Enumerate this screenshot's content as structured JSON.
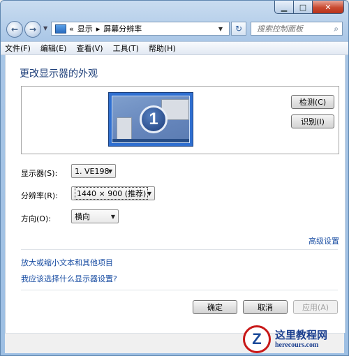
{
  "navigation": {
    "address_prefix": "«",
    "breadcrumb": [
      "显示",
      "屏幕分辨率"
    ],
    "search_placeholder": "搜索控制面板"
  },
  "menu": [
    "文件(F)",
    "编辑(E)",
    "查看(V)",
    "工具(T)",
    "帮助(H)"
  ],
  "main": {
    "title": "更改显示器的外观",
    "monitor_number": "1",
    "detect_button": "检测(C)",
    "identify_button": "识别(I)",
    "display_label": "显示器(S):",
    "display_value": "1. VE198",
    "resolution_label": "分辨率(R):",
    "resolution_value": "1440 × 900 (推荐)",
    "orientation_label": "方向(O):",
    "orientation_value": "横向",
    "advanced_link": "高级设置",
    "link_text_size": "放大或缩小文本和其他项目",
    "link_which_settings": "我应该选择什么显示器设置?"
  },
  "buttons": {
    "ok": "确定",
    "cancel": "取消",
    "apply": "应用(A)"
  },
  "watermark": {
    "logo_letter": "Z",
    "name": "这里教程网",
    "url": "herecours.com"
  },
  "colors": {
    "title": "#1e3f7a",
    "link": "#1a4ea3",
    "close_button": "#c94a30"
  }
}
